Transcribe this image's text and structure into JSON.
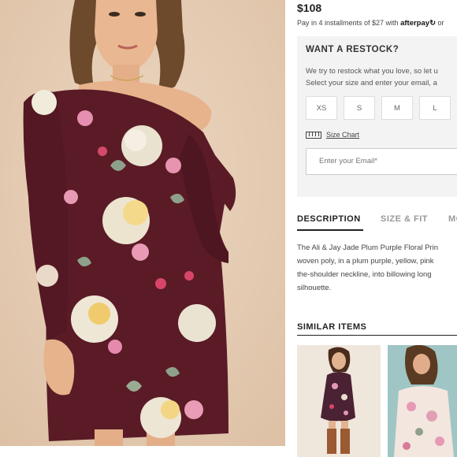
{
  "product": {
    "image_alt": "Model wearing plum floral off-the-shoulder dress",
    "price": "$108",
    "installments_text": "Pay in 4 installments of $27 with",
    "afterpay_brand": "afterpay",
    "afterpay_tail": "or",
    "colors": {
      "dress_plum": "#5a1b26",
      "background": "#e6ceb6",
      "accent": "#222222"
    }
  },
  "restock": {
    "title": "WANT A RESTOCK?",
    "line1": "We try to restock what you love, so let u",
    "line2": "Select your size and enter your email, a",
    "sizes": [
      "XS",
      "S",
      "M",
      "L"
    ],
    "size_chart_label": "Size Chart",
    "email_placeholder": "Enter your Email*"
  },
  "tabs": [
    {
      "label": "DESCRIPTION",
      "active": true
    },
    {
      "label": "SIZE & FIT",
      "active": false
    },
    {
      "label": "MO",
      "active": false
    }
  ],
  "description": {
    "lines": [
      "The Ali & Jay Jade Plum Purple Floral Prin",
      "woven poly, in a plum purple, yellow, pink",
      "the-shoulder neckline, into billowing long",
      "silhouette."
    ]
  },
  "similar": {
    "title": "SIMILAR ITEMS",
    "items": [
      {
        "name": "similar-item-1"
      },
      {
        "name": "similar-item-2"
      }
    ]
  }
}
